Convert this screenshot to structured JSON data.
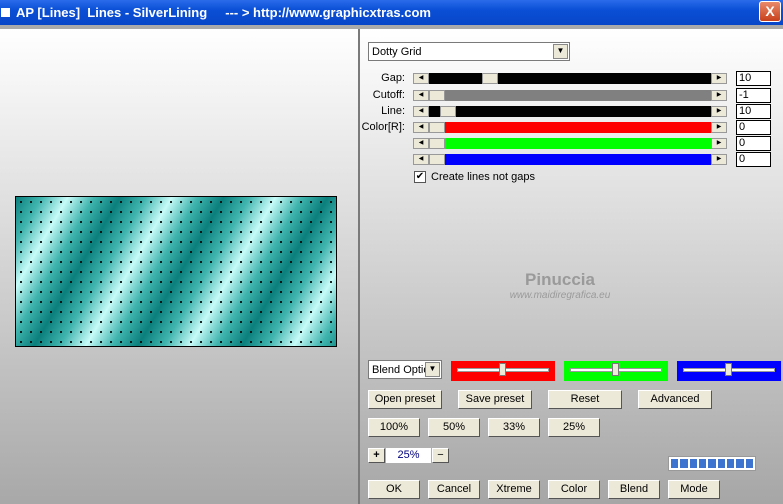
{
  "window": {
    "title": "AP [Lines]  Lines - SilverLining     --- > http://www.graphicxtras.com",
    "close": "X"
  },
  "preset_combo": {
    "value": "Dotty Grid"
  },
  "sliders": [
    {
      "label": "Gap:",
      "value": "10",
      "fraction": 0.2,
      "color": "#000000"
    },
    {
      "label": "Cutoff:",
      "value": "-1",
      "fraction": 0.0,
      "color": "#808080"
    },
    {
      "label": "Line:",
      "value": "10",
      "fraction": 0.04,
      "color": "#000000"
    },
    {
      "label": "Color[R]:",
      "value": "0",
      "fraction": 0.0,
      "color": "#ff0000"
    },
    {
      "label": "",
      "value": "0",
      "fraction": 0.0,
      "color": "#00ff00"
    },
    {
      "label": "",
      "value": "0",
      "fraction": 0.0,
      "color": "#0000ff"
    }
  ],
  "checkbox": {
    "label": "Create lines not gaps",
    "checked": true
  },
  "watermark": {
    "name": "Pinuccia",
    "url": "www.maidiregrafica.eu"
  },
  "blend_combo": {
    "value": "Blend Optio"
  },
  "color_sliders": [
    {
      "color": "#ff0000",
      "fraction": 0.5
    },
    {
      "color": "#00ff00",
      "fraction": 0.5
    },
    {
      "color": "#0000ff",
      "fraction": 0.5
    }
  ],
  "buttons_row1": [
    "Open preset",
    "Save preset",
    "Reset",
    "Advanced"
  ],
  "zoom_buttons": [
    "100%",
    "50%",
    "33%",
    "25%"
  ],
  "zoom": {
    "plus": "+",
    "value": "25%",
    "minus": "−"
  },
  "bottom_buttons": [
    "OK",
    "Cancel",
    "Xtreme",
    "Color",
    "Blend",
    "Mode"
  ],
  "progress": {
    "segments": 9
  }
}
